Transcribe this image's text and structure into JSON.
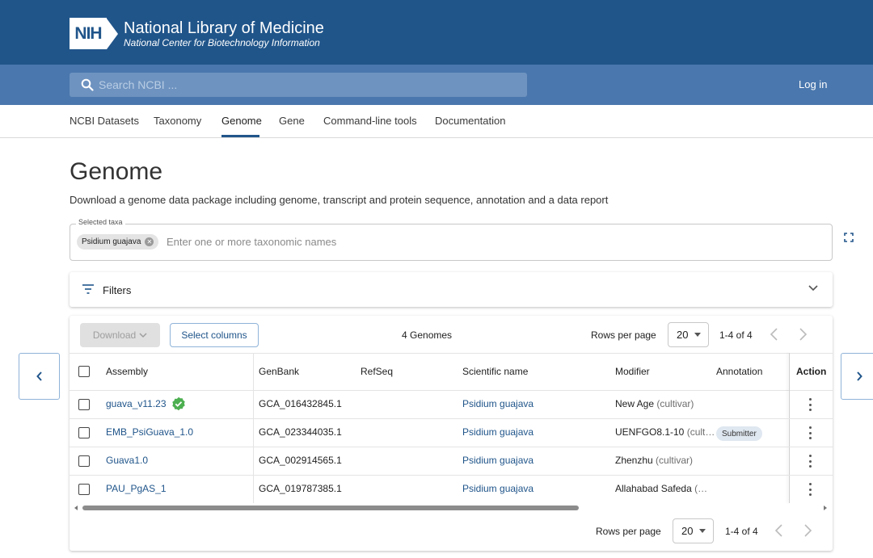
{
  "header": {
    "logo_text": "NIH",
    "title": "National Library of Medicine",
    "subtitle": "National Center for Biotechnology Information"
  },
  "search": {
    "placeholder": "Search NCBI ...",
    "login_label": "Log in"
  },
  "nav": {
    "items": [
      "NCBI Datasets",
      "Taxonomy",
      "Genome",
      "Gene",
      "Command-line tools",
      "Documentation"
    ],
    "active": "Genome"
  },
  "page": {
    "title": "Genome",
    "description": "Download a genome data package including genome, transcript and protein sequence, annotation and a data report"
  },
  "taxa": {
    "legend": "Selected taxa",
    "chip": "Psidium guajava",
    "placeholder": "Enter one or more taxonomic names"
  },
  "filters": {
    "label": "Filters"
  },
  "toolbar": {
    "download_label": "Download",
    "select_columns_label": "Select columns",
    "count_label": "4 Genomes",
    "rows_per_page_label": "Rows per page",
    "rows_per_page_value": "20",
    "range": "1-4 of 4"
  },
  "table": {
    "columns": [
      "Assembly",
      "GenBank",
      "RefSeq",
      "Scientific name",
      "Modifier",
      "Annotation",
      "Action"
    ],
    "rows": [
      {
        "assembly": "guava_v11.23",
        "genbank": "GCA_016432845.1",
        "refseq": "",
        "scientific_name": "Psidium guajava",
        "modifier": "New Age",
        "modifier_note": "(cultivar)",
        "annotation": ""
      },
      {
        "assembly": "EMB_PsiGuava_1.0",
        "genbank": "GCA_023344035.1",
        "refseq": "",
        "scientific_name": "Psidium guajava",
        "modifier": "UENFGO8.1-10",
        "modifier_note": "(cult…",
        "annotation": "Submitter"
      },
      {
        "assembly": "Guava1.0",
        "genbank": "GCA_002914565.1",
        "refseq": "",
        "scientific_name": "Psidium guajava",
        "modifier": "Zhenzhu",
        "modifier_note": "(cultivar)",
        "annotation": ""
      },
      {
        "assembly": "PAU_PgAS_1",
        "genbank": "GCA_019787385.1",
        "refseq": "",
        "scientific_name": "Psidium guajava",
        "modifier": "Allahabad Safeda",
        "modifier_note": "(…",
        "annotation": ""
      }
    ]
  },
  "footer_pagination": {
    "rows_per_page_label": "Rows per page",
    "rows_per_page_value": "20",
    "range": "1-4 of 4"
  },
  "colors": {
    "brand": "#20558a",
    "search_band": "#4a77ad",
    "link": "#20558a",
    "verified": "#4caf50"
  },
  "icons": [
    "search-icon",
    "cancel-chip-icon",
    "expand-icon",
    "filter-icon",
    "chevron-down-icon",
    "chevron-left-icon",
    "chevron-right-icon",
    "verified-check-icon",
    "more-vert-icon"
  ]
}
